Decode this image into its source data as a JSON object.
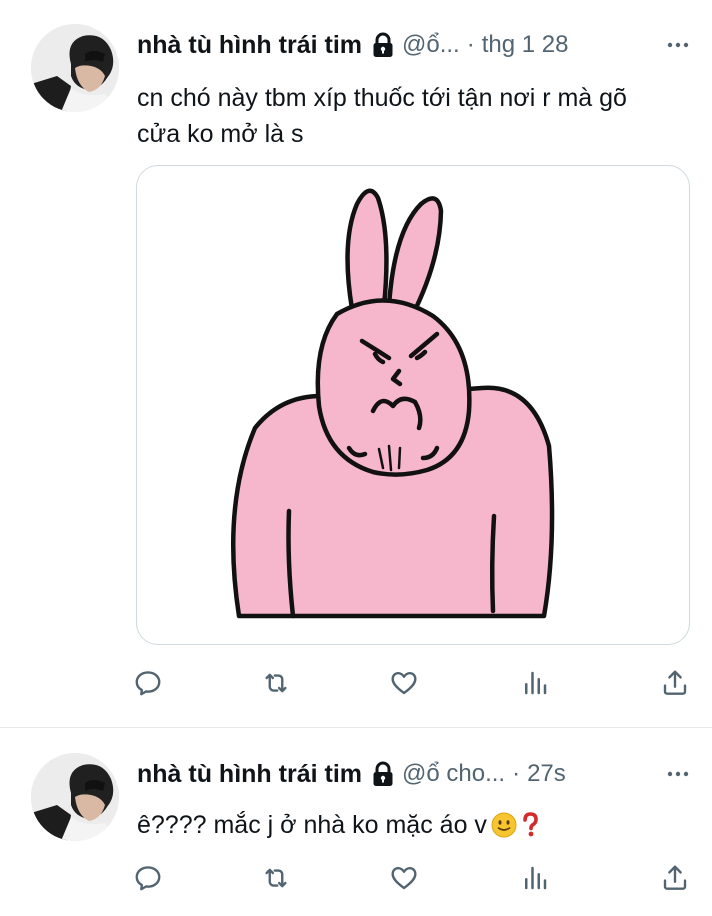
{
  "colors": {
    "text_primary": "#0f1419",
    "text_secondary": "#536471",
    "divider": "#e7e9ea",
    "bunny_pink": "#f6b6cc",
    "emoji_yellow": "#f7c52f",
    "question_red": "#d32a2a"
  },
  "tweets": [
    {
      "author_name": "nhà tù hình trái tim",
      "handle": "@ổ...",
      "separator": "·",
      "time": "thg 1 28",
      "text": "cn chó này tbm xíp thuốc tới tận nơi r mà gõ\ncửa ko mở là s",
      "media": "pink-angry-bunny-sticker",
      "icons": [
        "lock-icon",
        "more-icon",
        "reply-icon",
        "retweet-icon",
        "like-icon",
        "views-icon",
        "share-icon"
      ]
    },
    {
      "author_name": "nhà tù hình trái tim",
      "handle": "@ổ cho...",
      "separator": "·",
      "time": "27s",
      "text": "ê???? mắc j ở nhà ko mặc áo v",
      "icons": [
        "lock-icon",
        "more-icon",
        "smiley-emoji-icon",
        "question-emoji-icon",
        "reply-icon",
        "retweet-icon",
        "like-icon",
        "views-icon",
        "share-icon"
      ]
    }
  ]
}
